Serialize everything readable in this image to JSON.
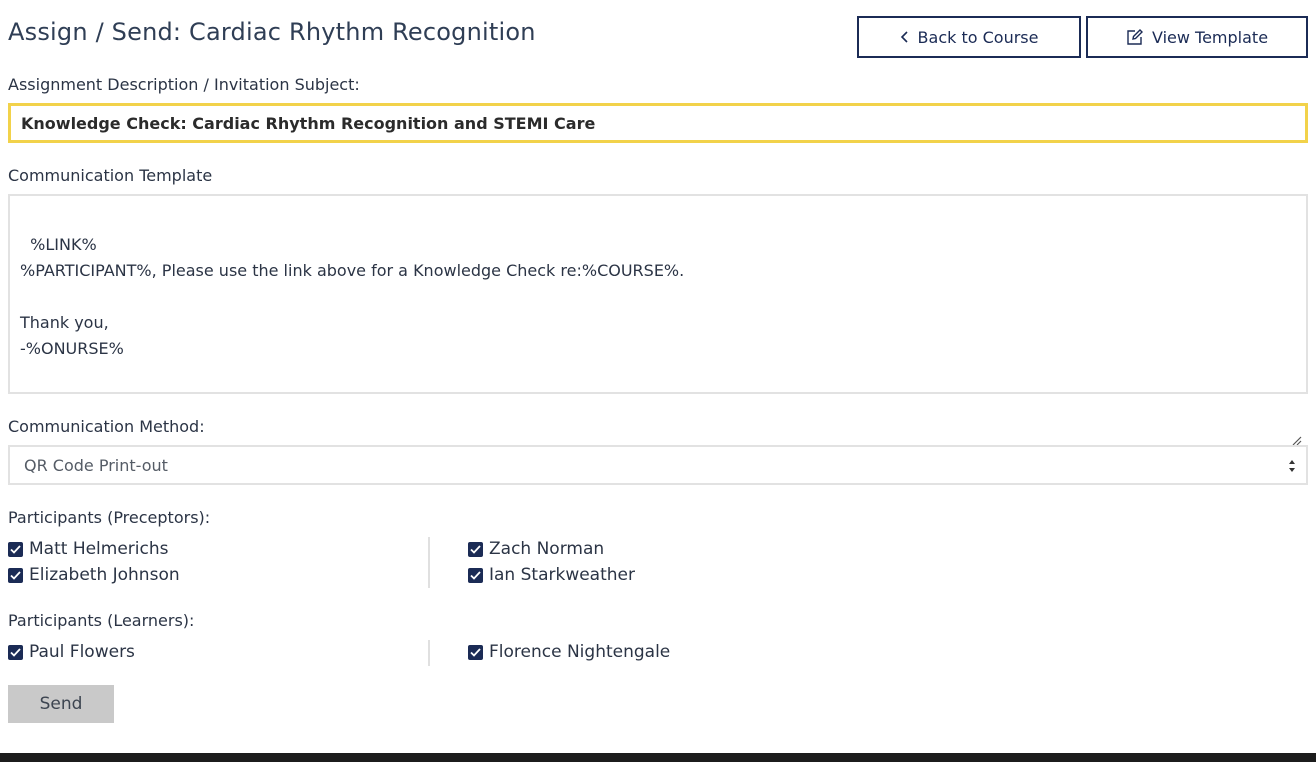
{
  "header": {
    "title": "Assign / Send: Cardiac Rhythm Recognition",
    "back_label": "Back to Course",
    "view_template_label": "View Template"
  },
  "subject": {
    "label": "Assignment Description / Invitation Subject:",
    "value": "Knowledge Check: Cardiac Rhythm Recognition and STEMI Care"
  },
  "template": {
    "label": "Communication Template",
    "value": "%LINK%\n%PARTICIPANT%, Please use the link above for a Knowledge Check re:%COURSE%.\n\nThank you,\n-%ONURSE%"
  },
  "method": {
    "label": "Communication Method:",
    "selected": "QR Code Print-out"
  },
  "preceptors": {
    "label": "Participants (Preceptors):",
    "left": [
      "Matt Helmerichs",
      "Elizabeth Johnson"
    ],
    "right": [
      "Zach Norman",
      "Ian Starkweather"
    ]
  },
  "learners": {
    "label": "Participants (Learners):",
    "left": [
      "Paul Flowers"
    ],
    "right": [
      "Florence Nightengale"
    ]
  },
  "send_label": "Send",
  "colors": {
    "primary": "#1b2b55",
    "focus": "#f2d24a",
    "send_bg": "#c9c9c9",
    "footer": "#1c1c1c"
  }
}
